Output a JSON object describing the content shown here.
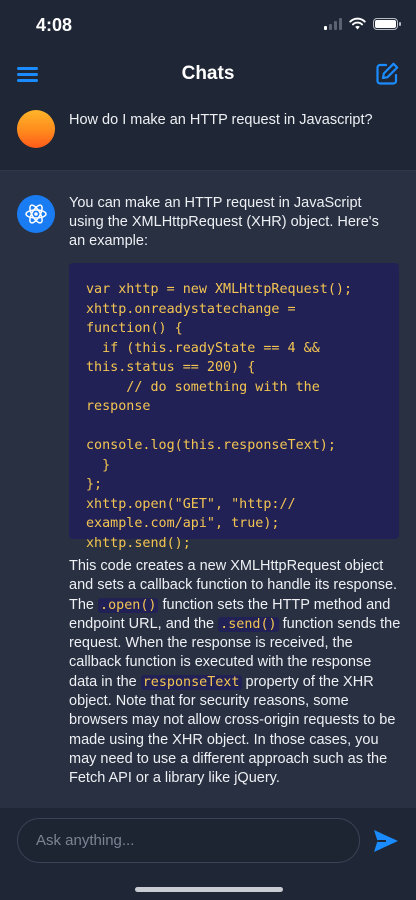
{
  "status_bar": {
    "time": "4:08"
  },
  "nav": {
    "title": "Chats"
  },
  "conversation": {
    "user_message": "How do I make an HTTP request in Javascript?",
    "assistant_intro": "You can make an HTTP request in JavaScript using the XMLHttpRequest (XHR) object. Here's an example:",
    "code_snippet": "var xhttp = new XMLHttpRequest();\nxhttp.onreadystatechange =\nfunction() {\n  if (this.readyState == 4 &&\nthis.status == 200) {\n     // do something with the\nresponse\n\nconsole.log(this.responseText);\n  }\n};\nxhttp.open(\"GET\", \"http://\nexample.com/api\", true);\nxhttp.send();",
    "explanation": {
      "part1": "This code creates a new XMLHttpRequest object and sets a callback function to handle its response. The ",
      "code1": ".open()",
      "part2": " function sets the HTTP method and endpoint URL, and the ",
      "code2": ".send()",
      "part3": " function sends the request. When the response is received, the callback function is executed with the response data in the ",
      "code3": "responseText",
      "part4": " property of the XHR object. Note that for security reasons, some browsers may not allow cross-origin requests to be made using the XHR object. In those cases, you may need to use a different approach such as the Fetch API or a library like jQuery."
    }
  },
  "composer": {
    "placeholder": "Ask anything..."
  },
  "colors": {
    "accent": "#1a8cff",
    "code_text": "#f4c552",
    "code_bg": "#212156",
    "background": "#1f2635",
    "assistant_bg": "#283041"
  },
  "icons": [
    "signal-icon",
    "wifi-icon",
    "battery-icon",
    "menu-icon",
    "compose-icon",
    "bot-icon",
    "send-icon"
  ]
}
